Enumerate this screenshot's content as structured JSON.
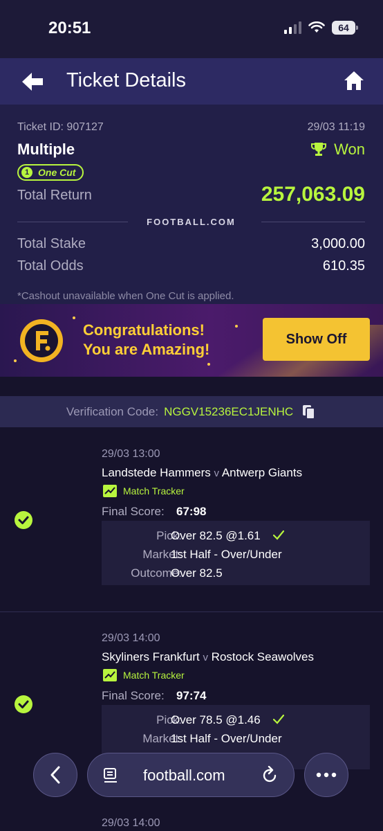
{
  "status_bar": {
    "time": "20:51",
    "battery": "64"
  },
  "header": {
    "title": "Ticket Details"
  },
  "ticket": {
    "id_text": "Ticket ID: 907127",
    "date": "29/03 11:19",
    "type": "Multiple",
    "status": "Won",
    "badge": "One Cut",
    "total_return_label": "Total Return",
    "total_return_value": "257,063.09",
    "brand": "FOOTBALL.COM",
    "total_stake_label": "Total Stake",
    "total_stake_value": "3,000.00",
    "total_odds_label": "Total Odds",
    "total_odds_value": "610.35",
    "note": "*Cashout unavailable when One Cut is applied."
  },
  "promo": {
    "line1": "Congratulations!",
    "line2": "You are Amazing!",
    "button": "Show Off"
  },
  "verification": {
    "label": "Verification Code:",
    "code": "NGGV15236EC1JENHC"
  },
  "matches": [
    {
      "time": "29/03 13:00",
      "home": "Landstede Hammers",
      "vs": "v",
      "away": "Antwerp Giants",
      "tracker": "Match Tracker",
      "score_label": "Final Score:",
      "score": "67:98",
      "pick_label": "Pick:",
      "pick": "Over 82.5 @1.61",
      "market_label": "Market:",
      "market": "1st Half - Over/Under",
      "outcome_label": "Outcome:",
      "outcome": "Over 82.5"
    },
    {
      "time": "29/03 14:00",
      "home": "Skyliners Frankfurt",
      "vs": "v",
      "away": "Rostock Seawolves",
      "tracker": "Match Tracker",
      "score_label": "Final Score:",
      "score": "97:74",
      "pick_label": "Pick:",
      "pick": "Over 78.5 @1.46",
      "market_label": "Market:",
      "market": "1st Half - Over/Under"
    },
    {
      "time": "29/03 14:00"
    }
  ],
  "browser": {
    "url": "football.com"
  },
  "colors": {
    "accent_green": "#b8f53e",
    "gold": "#f4c332",
    "header_bg": "#2d2a63"
  }
}
